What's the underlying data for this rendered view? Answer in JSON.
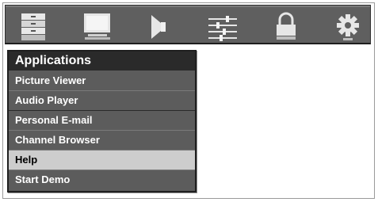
{
  "toolbar": {
    "icons": [
      {
        "name": "channel-list-icon"
      },
      {
        "name": "picture-settings-icon"
      },
      {
        "name": "audio-settings-icon"
      },
      {
        "name": "setup-sliders-icon"
      },
      {
        "name": "lock-icon"
      },
      {
        "name": "settings-gear-icon"
      }
    ]
  },
  "menu": {
    "title": "Applications",
    "items": [
      {
        "label": "Picture Viewer",
        "selected": false
      },
      {
        "label": "Audio Player",
        "selected": false
      },
      {
        "label": "Personal E-mail",
        "selected": false
      },
      {
        "label": "Channel Browser",
        "selected": false
      },
      {
        "label": "Help",
        "selected": true
      },
      {
        "label": "Start Demo",
        "selected": false
      }
    ]
  },
  "colors": {
    "bar_bg": "#5f5f5f",
    "menu_bg": "#5c5c5c",
    "title_bg": "#2a2a2a",
    "selected_bg": "#cdcdcd",
    "icon_light": "#e6e6e6"
  }
}
